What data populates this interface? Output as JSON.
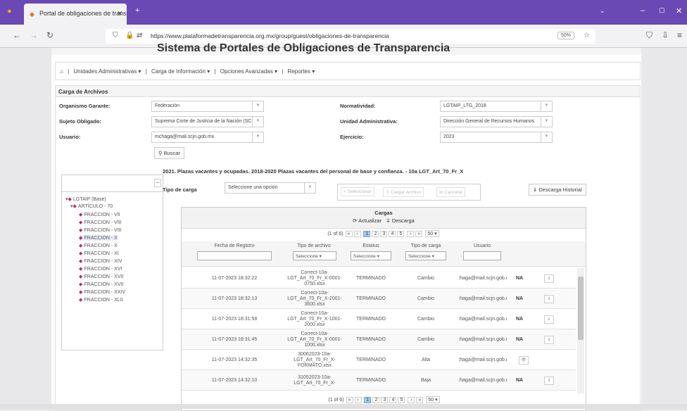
{
  "browser": {
    "tab_title": "Portal de obligaciones de trans",
    "url": "https://www.plataformadetransparencia.org.mx/group/guest/obligaciones-de-transparencia",
    "zoom": "50%"
  },
  "page_title": "Sistema de Portales de Obligaciones de Transparencia",
  "menu": [
    "Unidades Administrativas ▾",
    "Carga de Información ▾",
    "Opciones Avanzadas ▾",
    "Reportes ▾"
  ],
  "section_title": "Carga de Archivos",
  "form": {
    "organismo_label": "Organismo Garante:",
    "organismo_value": "Federación",
    "sujeto_label": "Sujeto Obligado:",
    "sujeto_value": "Suprema Corte de Justicia de la Nación (SC",
    "usuario_label": "Usuario:",
    "usuario_value": "mchaga@mail.scjn.gob.mx",
    "normatividad_label": "Normatividad:",
    "normatividad_value": "LGTAIP_LTG_2018",
    "unidad_label": "Unidad Administrativa:",
    "unidad_value": "Dirección General de Recursos Humanos",
    "ejercicio_label": "Ejercicio:",
    "ejercicio_value": "2023",
    "buscar": "Buscar"
  },
  "tree": {
    "root": "LGTAIP (Base)",
    "child": "ARTÍCULO - 70",
    "items": [
      "FRACCION - VII",
      "FRACCION - VIII",
      "FRACCION - VIII",
      "FRACCION - X",
      "FRACCION - X",
      "FRACCION - XI",
      "FRACCION - XIV",
      "FRACCION - XVI",
      "FRACCION - XVII",
      "FRACCION - XVII",
      "FRACCION - XXIV",
      "FRACCION - XLII"
    ]
  },
  "format_title": "2021. Plazas vacantes y ocupadas. 2018-2020 Plazas vacantes del personal de base y confianza. - 10a LGT_Art_70_Fr_X",
  "tipo_carga": {
    "label": "Tipo de carga",
    "placeholder": "Seleccione una opción"
  },
  "ops": [
    "Seleccionar",
    "Cargar Archivo",
    "Cancelar"
  ],
  "historial": "Descarga Historial",
  "grid": {
    "title": "Cargas",
    "actualizar": "Actualizar",
    "descarga": "Descarga",
    "page_info": "(1 of 6)",
    "pages": [
      "1",
      "2",
      "3",
      "4",
      "5"
    ],
    "rows_per_page": "50",
    "columns": [
      "Fecha de Registro",
      "Tipo de archivo",
      "Estatus",
      "Tipo de carga",
      "Usuario"
    ],
    "filter_select": "Seleccione",
    "rows": [
      {
        "fecha": "11-07-2023 18:32:22",
        "archivo": "Correct-10a-LGT_Art_70_Fr_X-0001-0750.xlsx",
        "estatus": "TERMINADO",
        "tipo": "Cambio",
        "usuario": "mchaga@mail.scjn.gob.mx",
        "na": "NA",
        "act": "⇓"
      },
      {
        "fecha": "11-07-2023 18:32:13",
        "archivo": "Correct-10a-LGT_Art_70_Fr_X-2001-3600.xlsx",
        "estatus": "TERMINADO",
        "tipo": "Cambio",
        "usuario": "mchaga@mail.scjn.gob.mx",
        "na": "NA",
        "act": "⇓"
      },
      {
        "fecha": "11-07-2023 18:31:58",
        "archivo": "Correct-10a-LGT_Art_70_Fr_X-1001-2000.xlsx",
        "estatus": "TERMINADO",
        "tipo": "Cambio",
        "usuario": "mchaga@mail.scjn.gob.mx",
        "na": "NA",
        "act": "⇓"
      },
      {
        "fecha": "11-07-2023 18:31:45",
        "archivo": "Correct-10a-LGT_Art_70_Fr_X-0001-1000.xlsx",
        "estatus": "TERMINADO",
        "tipo": "Cambio",
        "usuario": "mchaga@mail.scjn.gob.mx",
        "na": "NA",
        "act": "⇓"
      },
      {
        "fecha": "11-07-2023 14:32:35",
        "archivo": "30062023-10a-LGT_Art_70_Fr_X-FORMATO.xlsx",
        "estatus": "TERMINADO",
        "tipo": "Alta",
        "usuario": "mchaga@mail.scjn.gob.mx",
        "na": "",
        "act": "👁"
      },
      {
        "fecha": "11-07-2023 14:32:10",
        "archivo": "31052023-10a-LGT_Art_70_Fr_X-",
        "estatus": "TERMINADO",
        "tipo": "Baja",
        "usuario": "mchaga@mail.scjn.gob.mx",
        "na": "NA",
        "act": "⇓"
      }
    ]
  }
}
